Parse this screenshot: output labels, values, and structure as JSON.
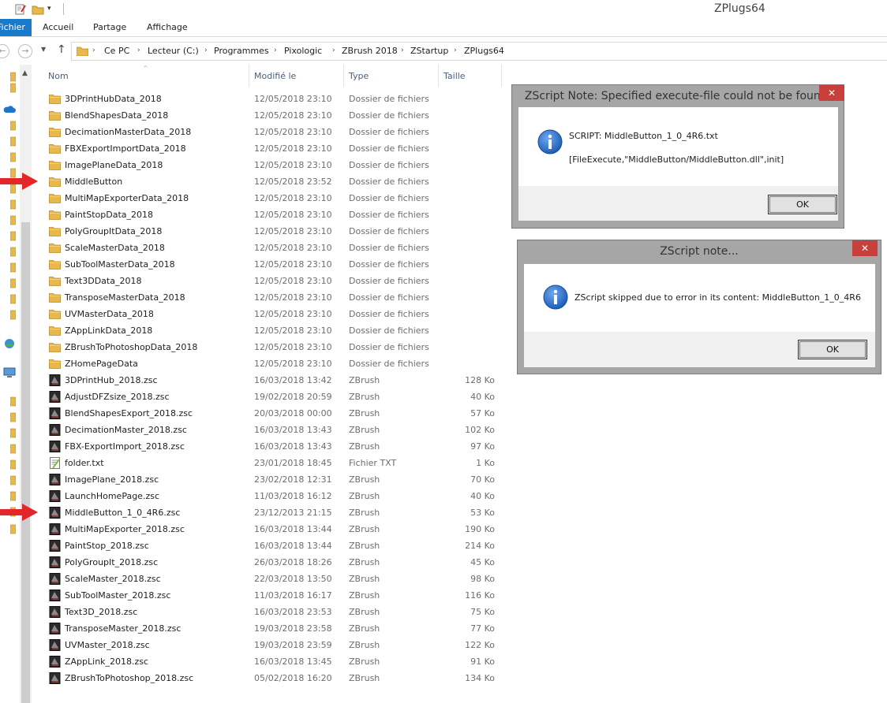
{
  "window": {
    "title": "ZPlugs64"
  },
  "ribbon": {
    "file_tab": "Fichier",
    "tabs": [
      "Accueil",
      "Partage",
      "Affichage"
    ]
  },
  "address": {
    "crumbs": [
      "Ce PC",
      "Lecteur (C:)",
      "Programmes",
      "Pixologic",
      "ZBrush 2018",
      "ZStartup",
      "ZPlugs64"
    ]
  },
  "columns": {
    "name": "Nom",
    "modified": "Modifié le",
    "type": "Type",
    "size": "Taille"
  },
  "files": [
    {
      "name": "3DPrintHubData_2018",
      "date": "12/05/2018 23:10",
      "type": "Dossier de fichiers",
      "size": "",
      "icon": "folder-icon"
    },
    {
      "name": "BlendShapesData_2018",
      "date": "12/05/2018 23:10",
      "type": "Dossier de fichiers",
      "size": "",
      "icon": "folder-icon"
    },
    {
      "name": "DecimationMasterData_2018",
      "date": "12/05/2018 23:10",
      "type": "Dossier de fichiers",
      "size": "",
      "icon": "folder-icon"
    },
    {
      "name": "FBXExportImportData_2018",
      "date": "12/05/2018 23:10",
      "type": "Dossier de fichiers",
      "size": "",
      "icon": "folder-icon"
    },
    {
      "name": "ImagePlaneData_2018",
      "date": "12/05/2018 23:10",
      "type": "Dossier de fichiers",
      "size": "",
      "icon": "folder-icon"
    },
    {
      "name": "MiddleButton",
      "date": "12/05/2018 23:52",
      "type": "Dossier de fichiers",
      "size": "",
      "icon": "folder-icon"
    },
    {
      "name": "MultiMapExporterData_2018",
      "date": "12/05/2018 23:10",
      "type": "Dossier de fichiers",
      "size": "",
      "icon": "folder-icon"
    },
    {
      "name": "PaintStopData_2018",
      "date": "12/05/2018 23:10",
      "type": "Dossier de fichiers",
      "size": "",
      "icon": "folder-icon"
    },
    {
      "name": "PolyGroupItData_2018",
      "date": "12/05/2018 23:10",
      "type": "Dossier de fichiers",
      "size": "",
      "icon": "folder-icon"
    },
    {
      "name": "ScaleMasterData_2018",
      "date": "12/05/2018 23:10",
      "type": "Dossier de fichiers",
      "size": "",
      "icon": "folder-icon"
    },
    {
      "name": "SubToolMasterData_2018",
      "date": "12/05/2018 23:10",
      "type": "Dossier de fichiers",
      "size": "",
      "icon": "folder-icon"
    },
    {
      "name": "Text3DData_2018",
      "date": "12/05/2018 23:10",
      "type": "Dossier de fichiers",
      "size": "",
      "icon": "folder-icon"
    },
    {
      "name": "TransposeMasterData_2018",
      "date": "12/05/2018 23:10",
      "type": "Dossier de fichiers",
      "size": "",
      "icon": "folder-icon"
    },
    {
      "name": "UVMasterData_2018",
      "date": "12/05/2018 23:10",
      "type": "Dossier de fichiers",
      "size": "",
      "icon": "folder-icon"
    },
    {
      "name": "ZAppLinkData_2018",
      "date": "12/05/2018 23:10",
      "type": "Dossier de fichiers",
      "size": "",
      "icon": "folder-icon"
    },
    {
      "name": "ZBrushToPhotoshopData_2018",
      "date": "12/05/2018 23:10",
      "type": "Dossier de fichiers",
      "size": "",
      "icon": "folder-icon"
    },
    {
      "name": "ZHomePageData",
      "date": "12/05/2018 23:10",
      "type": "Dossier de fichiers",
      "size": "",
      "icon": "folder-icon"
    },
    {
      "name": "3DPrintHub_2018.zsc",
      "date": "16/03/2018 13:42",
      "type": "ZBrush",
      "size": "128 Ko",
      "icon": "zbrush-file-icon"
    },
    {
      "name": "AdjustDFZsize_2018.zsc",
      "date": "19/02/2018 20:59",
      "type": "ZBrush",
      "size": "40 Ko",
      "icon": "zbrush-file-icon"
    },
    {
      "name": "BlendShapesExport_2018.zsc",
      "date": "20/03/2018 00:00",
      "type": "ZBrush",
      "size": "57 Ko",
      "icon": "zbrush-file-icon"
    },
    {
      "name": "DecimationMaster_2018.zsc",
      "date": "16/03/2018 13:43",
      "type": "ZBrush",
      "size": "102 Ko",
      "icon": "zbrush-file-icon"
    },
    {
      "name": "FBX-ExportImport_2018.zsc",
      "date": "16/03/2018 13:43",
      "type": "ZBrush",
      "size": "97 Ko",
      "icon": "zbrush-file-icon"
    },
    {
      "name": "folder.txt",
      "date": "23/01/2018 18:45",
      "type": "Fichier TXT",
      "size": "1 Ko",
      "icon": "text-file-icon"
    },
    {
      "name": "ImagePlane_2018.zsc",
      "date": "23/02/2018 12:31",
      "type": "ZBrush",
      "size": "70 Ko",
      "icon": "zbrush-file-icon"
    },
    {
      "name": "LaunchHomePage.zsc",
      "date": "11/03/2018 16:12",
      "type": "ZBrush",
      "size": "40 Ko",
      "icon": "zbrush-file-icon"
    },
    {
      "name": "MiddleButton_1_0_4R6.zsc",
      "date": "23/12/2013 21:15",
      "type": "ZBrush",
      "size": "53 Ko",
      "icon": "zbrush-file-icon"
    },
    {
      "name": "MultiMapExporter_2018.zsc",
      "date": "16/03/2018 13:44",
      "type": "ZBrush",
      "size": "190 Ko",
      "icon": "zbrush-file-icon"
    },
    {
      "name": "PaintStop_2018.zsc",
      "date": "16/03/2018 13:44",
      "type": "ZBrush",
      "size": "214 Ko",
      "icon": "zbrush-file-icon"
    },
    {
      "name": "PolyGroupIt_2018.zsc",
      "date": "26/03/2018 18:26",
      "type": "ZBrush",
      "size": "45 Ko",
      "icon": "zbrush-file-icon"
    },
    {
      "name": "ScaleMaster_2018.zsc",
      "date": "22/03/2018 13:50",
      "type": "ZBrush",
      "size": "98 Ko",
      "icon": "zbrush-file-icon"
    },
    {
      "name": "SubToolMaster_2018.zsc",
      "date": "11/03/2018 16:17",
      "type": "ZBrush",
      "size": "116 Ko",
      "icon": "zbrush-file-icon"
    },
    {
      "name": "Text3D_2018.zsc",
      "date": "16/03/2018 23:53",
      "type": "ZBrush",
      "size": "75 Ko",
      "icon": "zbrush-file-icon"
    },
    {
      "name": "TransposeMaster_2018.zsc",
      "date": "19/03/2018 23:58",
      "type": "ZBrush",
      "size": "77 Ko",
      "icon": "zbrush-file-icon"
    },
    {
      "name": "UVMaster_2018.zsc",
      "date": "19/03/2018 23:59",
      "type": "ZBrush",
      "size": "122 Ko",
      "icon": "zbrush-file-icon"
    },
    {
      "name": "ZAppLink_2018.zsc",
      "date": "16/03/2018 13:45",
      "type": "ZBrush",
      "size": "91 Ko",
      "icon": "zbrush-file-icon"
    },
    {
      "name": "ZBrushToPhotoshop_2018.zsc",
      "date": "05/02/2018 16:20",
      "type": "ZBrush",
      "size": "134 Ko",
      "icon": "zbrush-file-icon"
    }
  ],
  "dialog1": {
    "title": "ZScript Note: Specified execute-file could not be found.",
    "line1": "SCRIPT: MiddleButton_1_0_4R6.txt",
    "line2": "[FileExecute,\"MiddleButton/MiddleButton.dll\",init]",
    "ok": "OK",
    "close": "✕"
  },
  "dialog2": {
    "title": "ZScript note...",
    "message": "ZScript skipped due to error in its content: MiddleButton_1_0_4R6",
    "ok": "OK",
    "close": "✕"
  },
  "colors": {
    "file_tab": "#1979ca",
    "folder": "#e8b94a",
    "close_button": "#c7403b",
    "annotation_arrow": "#e3262a",
    "info_icon": "#1d5fb8"
  }
}
